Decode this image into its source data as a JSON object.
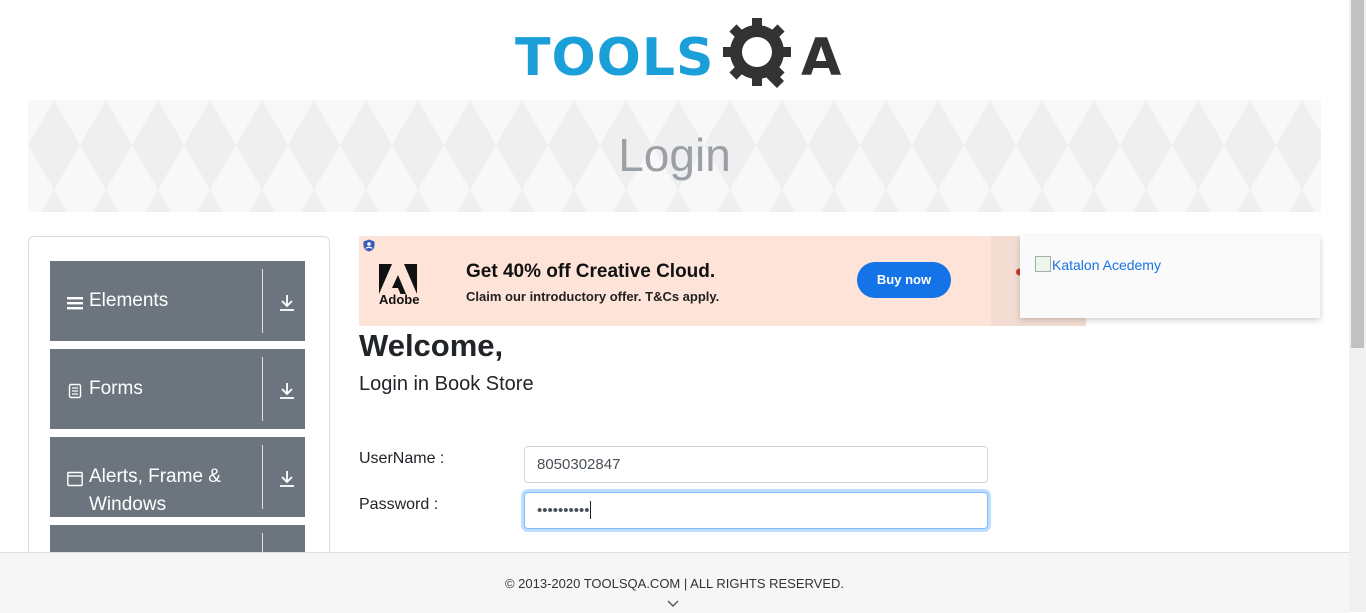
{
  "header": {
    "logo_text": "TOOLS",
    "logo_suffix": "A"
  },
  "banner": {
    "title": "Login"
  },
  "sidebar": {
    "groups": [
      {
        "label": "Elements",
        "icon": "hamburger-icon"
      },
      {
        "label": "Forms",
        "icon": "document-icon"
      },
      {
        "label": "Alerts, Frame & Windows",
        "icon": "window-icon"
      }
    ]
  },
  "ad": {
    "brand": "Adobe",
    "headline": "Get 40% off Creative Cloud.",
    "subline": "Claim our introductory offer. T&Cs apply.",
    "button": "Buy now"
  },
  "side_ad": {
    "alt_text": "Katalon Acedemy"
  },
  "main": {
    "welcome": "Welcome,",
    "subtitle": "Login in Book Store",
    "username_label": "UserName :",
    "username_value": "8050302847",
    "password_label": "Password :",
    "password_value": "••••••••••"
  },
  "footer": {
    "text": "© 2013-2020 TOOLSQA.COM | ALL RIGHTS RESERVED."
  },
  "colors": {
    "brand_blue": "#1a9fd9",
    "menu_gray": "#6c757d",
    "ad_button": "#1473e6"
  }
}
